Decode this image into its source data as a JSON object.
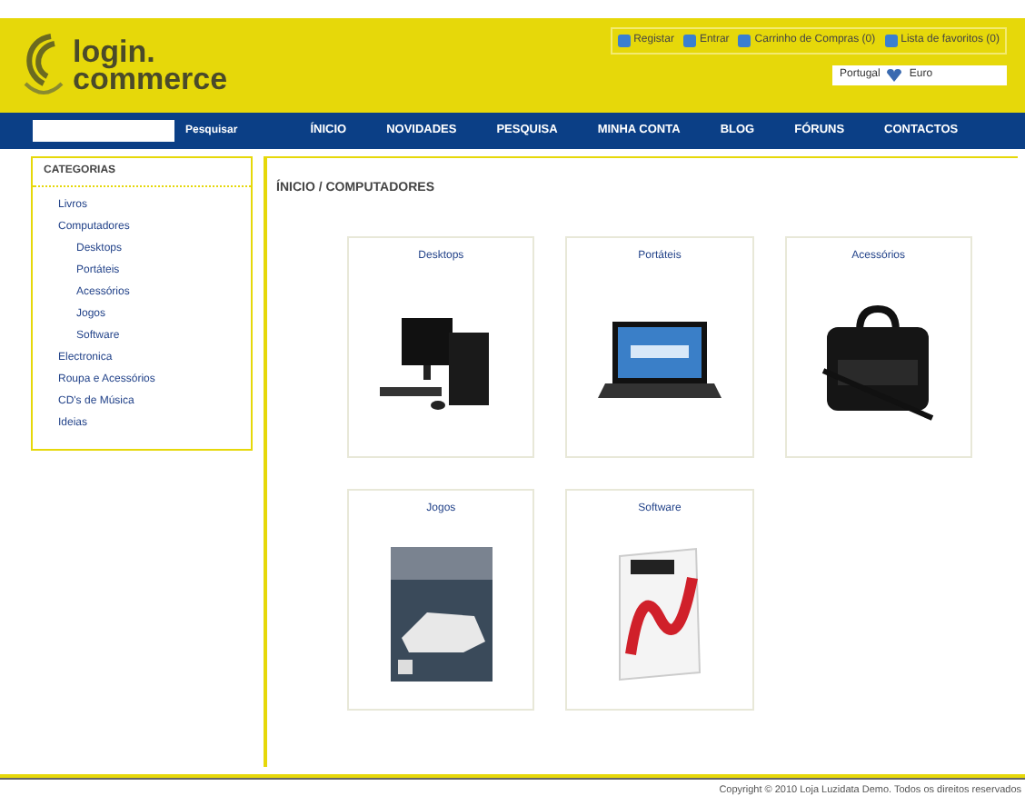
{
  "logo": {
    "line_1": "login.",
    "line_2": "commerce"
  },
  "top_links": [
    {
      "label": "Registar"
    },
    {
      "label": "Entrar"
    },
    {
      "label": "Carrinho de Compras (0)"
    },
    {
      "label": "Lista de favoritos (0)"
    }
  ],
  "locale": {
    "country": "Portugal",
    "currency": "Euro"
  },
  "search": {
    "button": "Pesquisar"
  },
  "nav": [
    {
      "label": "ÍNICIO"
    },
    {
      "label": "NOVIDADES"
    },
    {
      "label": "PESQUISA"
    },
    {
      "label": "MINHA CONTA"
    },
    {
      "label": "BLOG"
    },
    {
      "label": "FÓRUNS"
    },
    {
      "label": "CONTACTOS"
    }
  ],
  "sidebar": {
    "title": "CATEGORIAS",
    "items": [
      {
        "label": "Livros"
      },
      {
        "label": "Computadores",
        "children": [
          {
            "label": "Desktops"
          },
          {
            "label": "Portáteis"
          },
          {
            "label": "Acessórios"
          },
          {
            "label": "Jogos"
          },
          {
            "label": "Software"
          }
        ]
      },
      {
        "label": "Electronica"
      },
      {
        "label": "Roupa e Acessórios"
      },
      {
        "label": "CD's de Música"
      },
      {
        "label": "Ideias"
      }
    ]
  },
  "breadcrumb": "ÍNICIO / COMPUTADORES",
  "products": [
    {
      "label": "Desktops",
      "kind": "desktop"
    },
    {
      "label": "Portáteis",
      "kind": "laptop"
    },
    {
      "label": "Acessórios",
      "kind": "bag"
    },
    {
      "label": "Jogos",
      "kind": "game"
    },
    {
      "label": "Software",
      "kind": "software"
    }
  ],
  "footer": "Copyright © 2010 Loja Luzidata Demo. Todos os direitos reservados"
}
